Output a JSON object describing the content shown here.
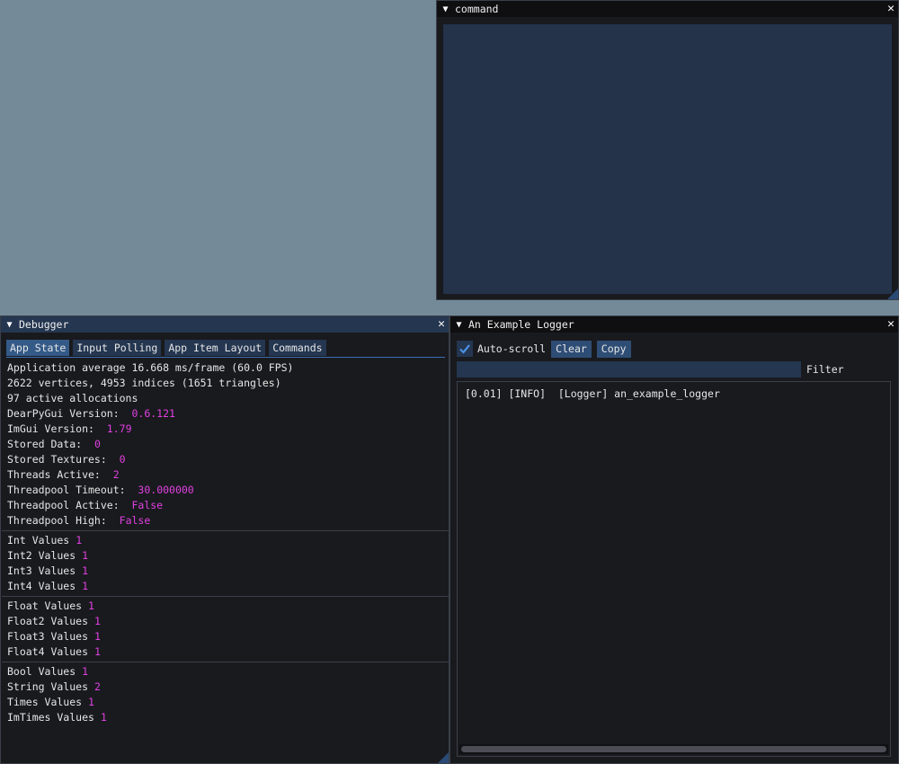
{
  "command_window": {
    "title": "command",
    "close_glyph": "✕"
  },
  "debugger": {
    "title": "Debugger",
    "close_glyph": "✕",
    "tabs": [
      "App State",
      "Input Polling",
      "App Item Layout",
      "Commands"
    ],
    "stats": {
      "fps_line": "Application average 16.668 ms/frame (60.0 FPS)",
      "vertices_line": "2622 vertices, 4953 indices (1651 triangles)",
      "allocations_line": "97 active allocations"
    },
    "state": [
      {
        "label": "DearPyGui Version:",
        "value": "0.6.121"
      },
      {
        "label": "ImGui Version:",
        "value": "1.79"
      },
      {
        "label": "Stored Data:",
        "value": "0"
      },
      {
        "label": "Stored Textures:",
        "value": "0"
      },
      {
        "label": "Threads Active:",
        "value": "2"
      },
      {
        "label": "Threadpool Timeout:",
        "value": "30.000000"
      },
      {
        "label": "Threadpool Active:",
        "value": "False"
      },
      {
        "label": "Threadpool High:",
        "value": "False"
      }
    ],
    "int_values": [
      {
        "label": "Int Values",
        "value": "1"
      },
      {
        "label": "Int2 Values",
        "value": "1"
      },
      {
        "label": "Int3 Values",
        "value": "1"
      },
      {
        "label": "Int4 Values",
        "value": "1"
      }
    ],
    "float_values": [
      {
        "label": "Float Values",
        "value": "1"
      },
      {
        "label": "Float2 Values",
        "value": "1"
      },
      {
        "label": "Float3 Values",
        "value": "1"
      },
      {
        "label": "Float4 Values",
        "value": "1"
      }
    ],
    "misc_values": [
      {
        "label": "Bool Values",
        "value": "1"
      },
      {
        "label": "String Values",
        "value": "2"
      },
      {
        "label": "Times Values",
        "value": "1"
      },
      {
        "label": "ImTimes Values",
        "value": "1"
      }
    ]
  },
  "logger": {
    "title": "An Example Logger",
    "close_glyph": "✕",
    "auto_scroll_label": "Auto-scroll",
    "auto_scroll_checked": true,
    "clear_label": "Clear",
    "copy_label": "Copy",
    "filter_value": "",
    "filter_label": "Filter",
    "log_lines": [
      "[0.01] [INFO]  [Logger] an_example_logger"
    ]
  },
  "colors": {
    "background": "#748a99",
    "value_magenta": "#e040e0",
    "active_title": "#253650"
  }
}
